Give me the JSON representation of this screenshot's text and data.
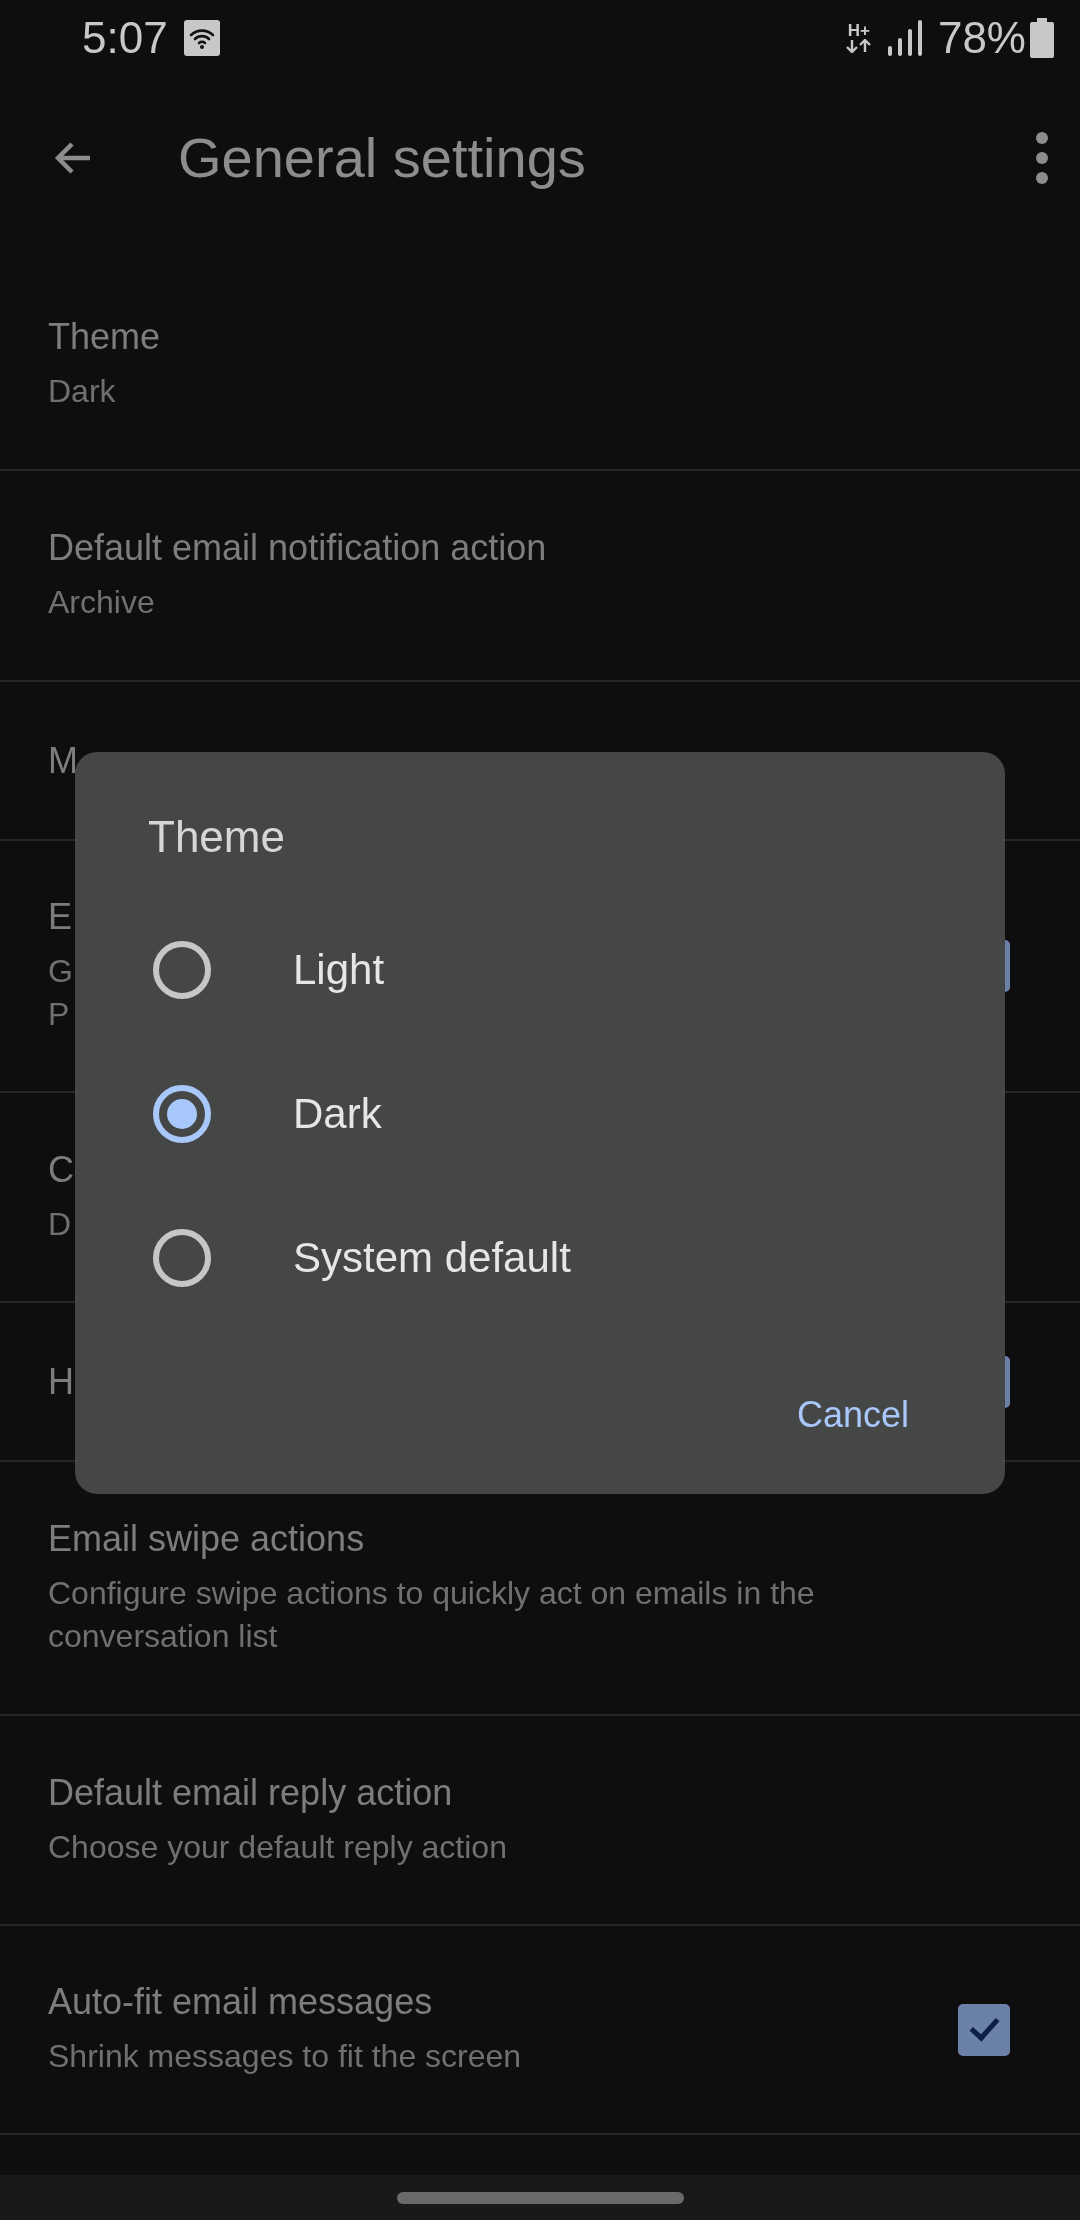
{
  "status_bar": {
    "time": "5:07",
    "network_type": "H+",
    "battery": "78%"
  },
  "header": {
    "title": "General settings"
  },
  "settings": [
    {
      "kind": "text",
      "title": "Theme",
      "subtitle": "Dark"
    },
    {
      "kind": "text",
      "title": "Default email notification action",
      "subtitle": "Archive"
    },
    {
      "kind": "text",
      "title": "M"
    },
    {
      "kind": "checkbox",
      "title": "E",
      "subtitle": "G\nP",
      "checked": true
    },
    {
      "kind": "text",
      "title": "C",
      "subtitle": "D"
    },
    {
      "kind": "checkbox",
      "title": "H",
      "checked": true
    },
    {
      "kind": "text",
      "title": "Email swipe actions",
      "subtitle": "Configure swipe actions to quickly act on emails in the conversation list"
    },
    {
      "kind": "text",
      "title": "Default email reply action",
      "subtitle": "Choose your default reply action"
    },
    {
      "kind": "checkbox",
      "title": "Auto-fit email messages",
      "subtitle": "Shrink messages to fit the screen",
      "checked": true
    }
  ],
  "dialog": {
    "title": "Theme",
    "options": [
      {
        "label": "Light",
        "selected": false
      },
      {
        "label": "Dark",
        "selected": true
      },
      {
        "label": "System default",
        "selected": false
      }
    ],
    "buttons": [
      {
        "label": "Cancel"
      }
    ]
  }
}
